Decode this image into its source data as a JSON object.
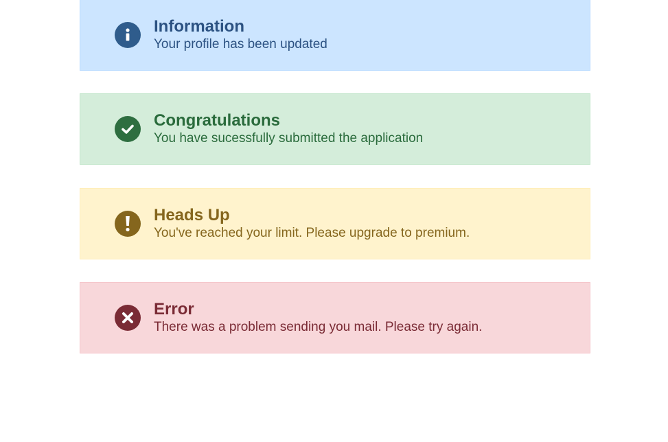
{
  "alerts": [
    {
      "type": "info",
      "icon": "info-icon",
      "title": "Information",
      "message": "Your profile has been updated",
      "color": "#cce5ff"
    },
    {
      "type": "success",
      "icon": "check-icon",
      "title": "Congratulations",
      "message": "You have sucessfully submitted the application",
      "color": "#d4edda"
    },
    {
      "type": "warning",
      "icon": "exclamation-icon",
      "title": "Heads Up",
      "message": "You've reached your limit. Please upgrade to premium.",
      "color": "#fff3cd"
    },
    {
      "type": "error",
      "icon": "times-icon",
      "title": "Error",
      "message": "There was a problem sending you mail. Please try again.",
      "color": "#f8d7da"
    }
  ]
}
